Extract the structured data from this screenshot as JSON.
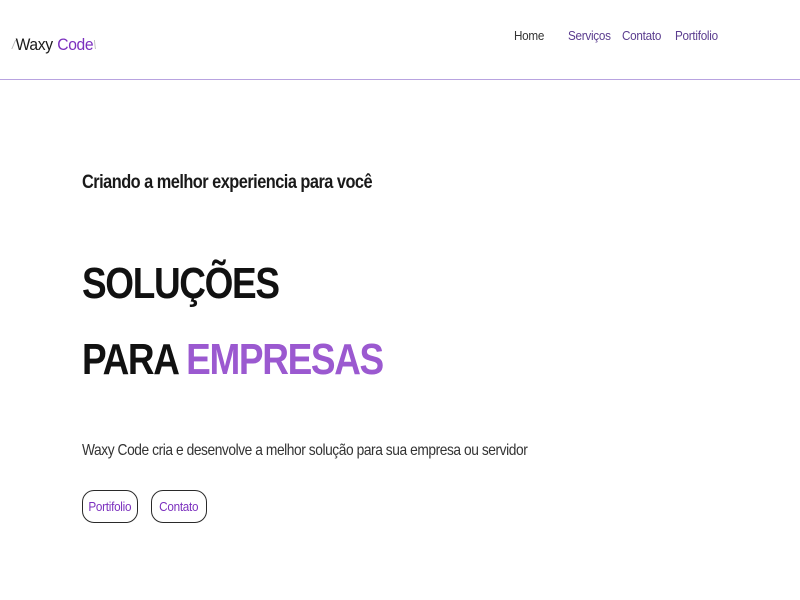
{
  "header": {
    "logo": {
      "slash_left": "/",
      "word1": "Waxy",
      "word2": "Code",
      "slash_right": "\\"
    },
    "nav": [
      {
        "label": "Home"
      },
      {
        "label": "Serviços"
      },
      {
        "label": "Contato"
      },
      {
        "label": "Portifolio"
      }
    ]
  },
  "hero": {
    "tagline": "Criando a melhor experiencia para você",
    "headline_line1": "SOLUÇÕES",
    "headline_line2_prefix": "PARA ",
    "headline_line2_accent": "EMPRESAS",
    "description": "Waxy Code cria e desenvolve a melhor solução para sua empresa ou servidor",
    "buttons": [
      {
        "label": "Portifolio"
      },
      {
        "label": "Contato"
      }
    ]
  },
  "colors": {
    "accent": "#9b59d0",
    "accent_dark": "#7b2fbe",
    "divider": "#b8a3e0",
    "text": "#111111"
  }
}
